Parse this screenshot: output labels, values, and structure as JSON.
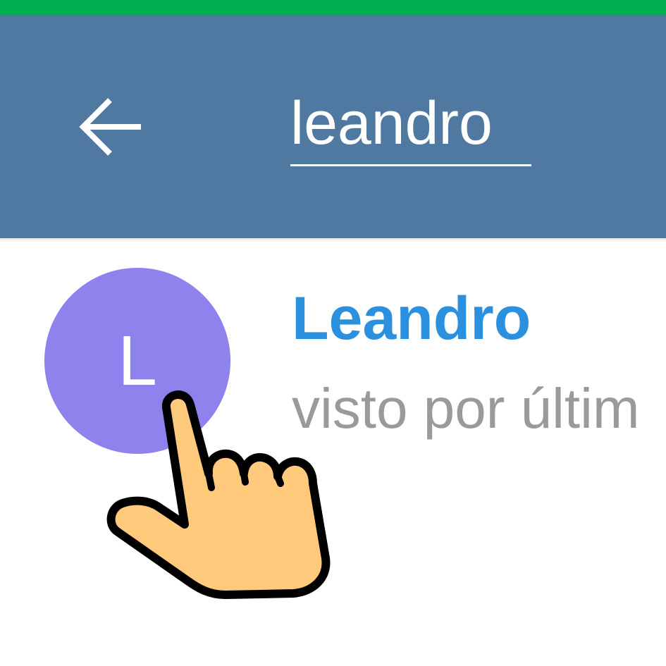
{
  "colors": {
    "status_bar": "#00b050",
    "app_bar": "#5079a1",
    "avatar": "#8e83ec",
    "name_accent": "#2b91df",
    "status_text": "#9a9a9a",
    "hand_fill": "#ffca7b",
    "hand_outline": "#000000"
  },
  "header": {
    "back_icon": "arrow-left-icon",
    "search_value": "leandro"
  },
  "results": [
    {
      "avatar_initial": "L",
      "name": "Leandro",
      "status": "visto por últim"
    }
  ],
  "overlay": {
    "icon": "pointing-hand-icon"
  }
}
